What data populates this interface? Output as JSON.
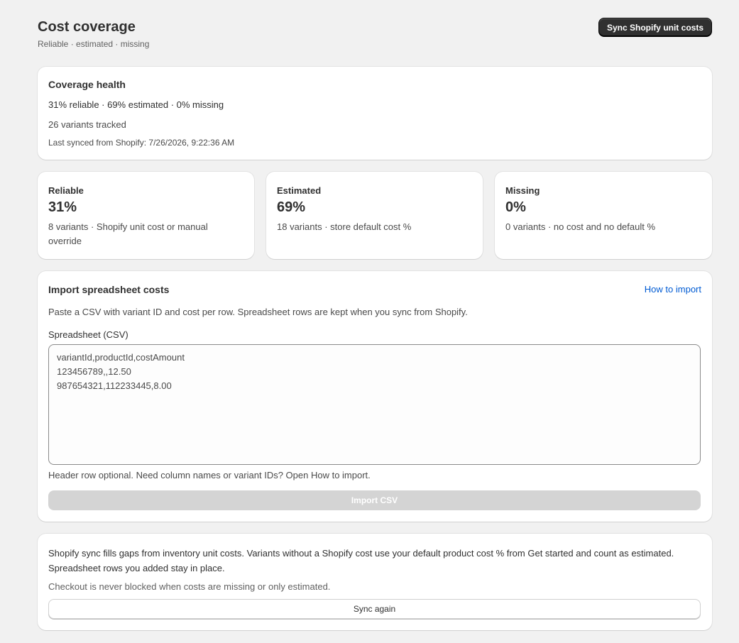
{
  "header": {
    "title": "Cost coverage",
    "subtitle": "Reliable · estimated · missing",
    "sync_button": "Sync Shopify unit costs"
  },
  "health": {
    "title": "Coverage health",
    "summary": "31% reliable · 69% estimated · 0% missing",
    "tracked": "26 variants tracked",
    "last_synced": "Last synced from Shopify: 7/26/2026, 9:22:36 AM"
  },
  "stats": [
    {
      "label": "Reliable",
      "value": "31%",
      "desc": "8 variants · Shopify unit cost or manual override"
    },
    {
      "label": "Estimated",
      "value": "69%",
      "desc": "18 variants · store default cost %"
    },
    {
      "label": "Missing",
      "value": "0%",
      "desc": "0 variants · no cost and no default %"
    }
  ],
  "import": {
    "title": "Import spreadsheet costs",
    "how_link": "How to import",
    "help": "Paste a CSV with variant ID and cost per row. Spreadsheet rows are kept when you sync from Shopify.",
    "field_label": "Spreadsheet (CSV)",
    "csv_value": "variantId,productId,costAmount\n123456789,,12.50\n987654321,112233445,8.00",
    "hint": "Header row optional. Need column names or variant IDs? Open How to import.",
    "import_button": "Import CSV"
  },
  "sync": {
    "description": "Shopify sync fills gaps from inventory unit costs. Variants without a Shopify cost use your default product cost % from Get started and count as estimated. Spreadsheet rows you added stay in place.",
    "note": "Checkout is never blocked when costs are missing or only estimated.",
    "button": "Sync again"
  }
}
